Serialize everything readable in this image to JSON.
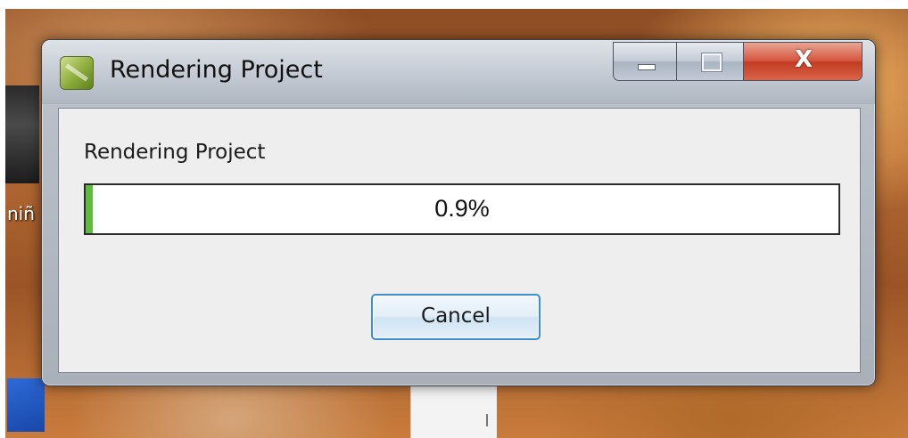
{
  "desktop": {
    "icon_label": "niñ"
  },
  "window": {
    "title": "Rendering Project",
    "icon": "app-icon",
    "buttons": {
      "minimize_icon": "minimize-icon",
      "maximize_icon": "maximize-icon",
      "close_label": "X"
    }
  },
  "dialog": {
    "label": "Rendering Project",
    "progress": {
      "text": "0.9%",
      "value_percent": 0.9
    },
    "cancel_label": "Cancel"
  },
  "colors": {
    "progress_fill": "#5cbd3c",
    "close_button": "#c23c22",
    "cancel_focus_border": "#3d8fd0"
  }
}
